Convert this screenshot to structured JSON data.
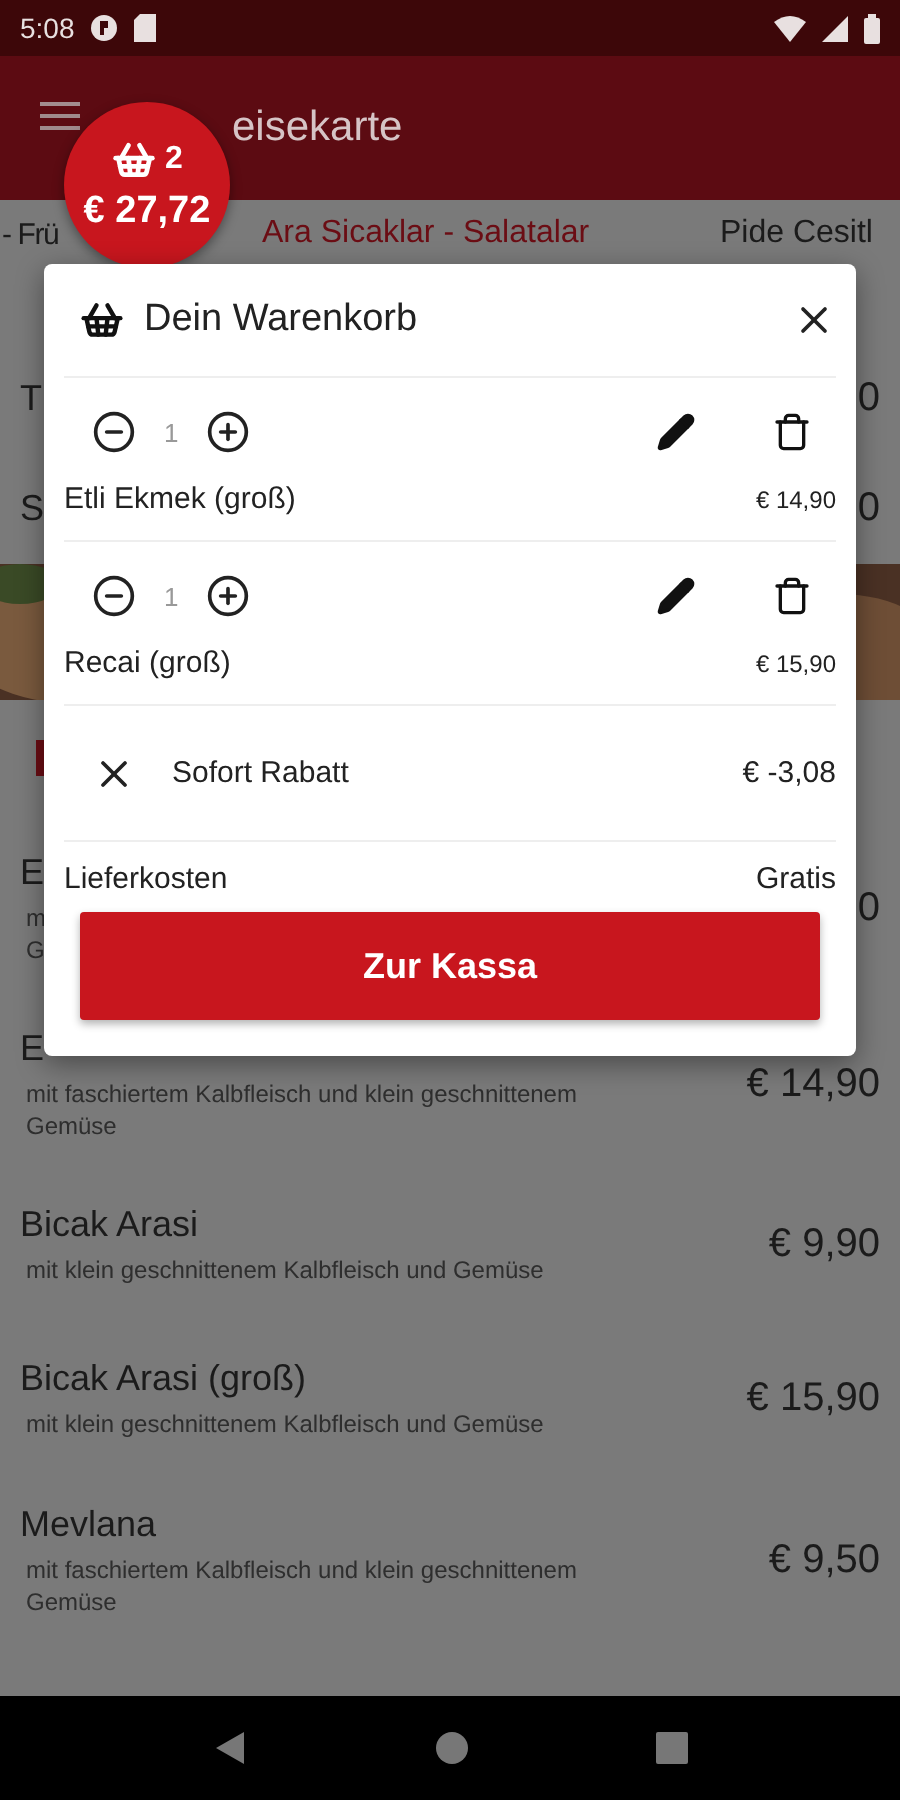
{
  "status_bar": {
    "time": "5:08"
  },
  "app_bar": {
    "title": "eisekarte"
  },
  "cart_badge": {
    "count": "2",
    "total": "€ 27,72"
  },
  "tabs": [
    {
      "label": "- Frü",
      "selected": false
    },
    {
      "label": "Ara Sicaklar - Salatalar",
      "selected": true
    },
    {
      "label": "Pide Cesitl",
      "selected": false
    }
  ],
  "menu": [
    {
      "kind": "item",
      "name": "T",
      "price": "0"
    },
    {
      "kind": "item",
      "name": "S",
      "price": "0"
    },
    {
      "kind": "picture"
    },
    {
      "kind": "header"
    },
    {
      "kind": "item",
      "name": "E",
      "description_lines": [
        "m",
        "G"
      ],
      "price": "0"
    },
    {
      "kind": "item",
      "name": "E",
      "description_lines": [
        "mit faschiertem Kalbfleisch und klein geschnittenem",
        "Gemüse"
      ],
      "price": "€ 14,90"
    },
    {
      "kind": "item",
      "name": "Bicak Arasi",
      "description_lines": [
        "mit klein geschnittenem Kalbfleisch und Gemüse"
      ],
      "price": "€ 9,90"
    },
    {
      "kind": "item",
      "name": "Bicak Arasi (groß)",
      "description_lines": [
        "mit klein geschnittenem Kalbfleisch und Gemüse"
      ],
      "price": "€ 15,90"
    },
    {
      "kind": "item",
      "name": "Mevlana",
      "description_lines": [
        "mit faschiertem Kalbfleisch und klein geschnittenem",
        "Gemüse"
      ],
      "price": "€ 9,50"
    }
  ],
  "cart": {
    "title": "Dein Warenkorb",
    "lines": [
      {
        "quantity": "1",
        "name": "Etli Ekmek (groß)",
        "price": "€ 14,90"
      },
      {
        "quantity": "1",
        "name": "Recai (groß)",
        "price": "€ 15,90"
      }
    ],
    "discount": {
      "label": "Sofort Rabatt",
      "amount": "€ -3,08"
    },
    "delivery": {
      "label": "Lieferkosten",
      "value": "Gratis"
    },
    "checkout": "Zur Kassa"
  }
}
